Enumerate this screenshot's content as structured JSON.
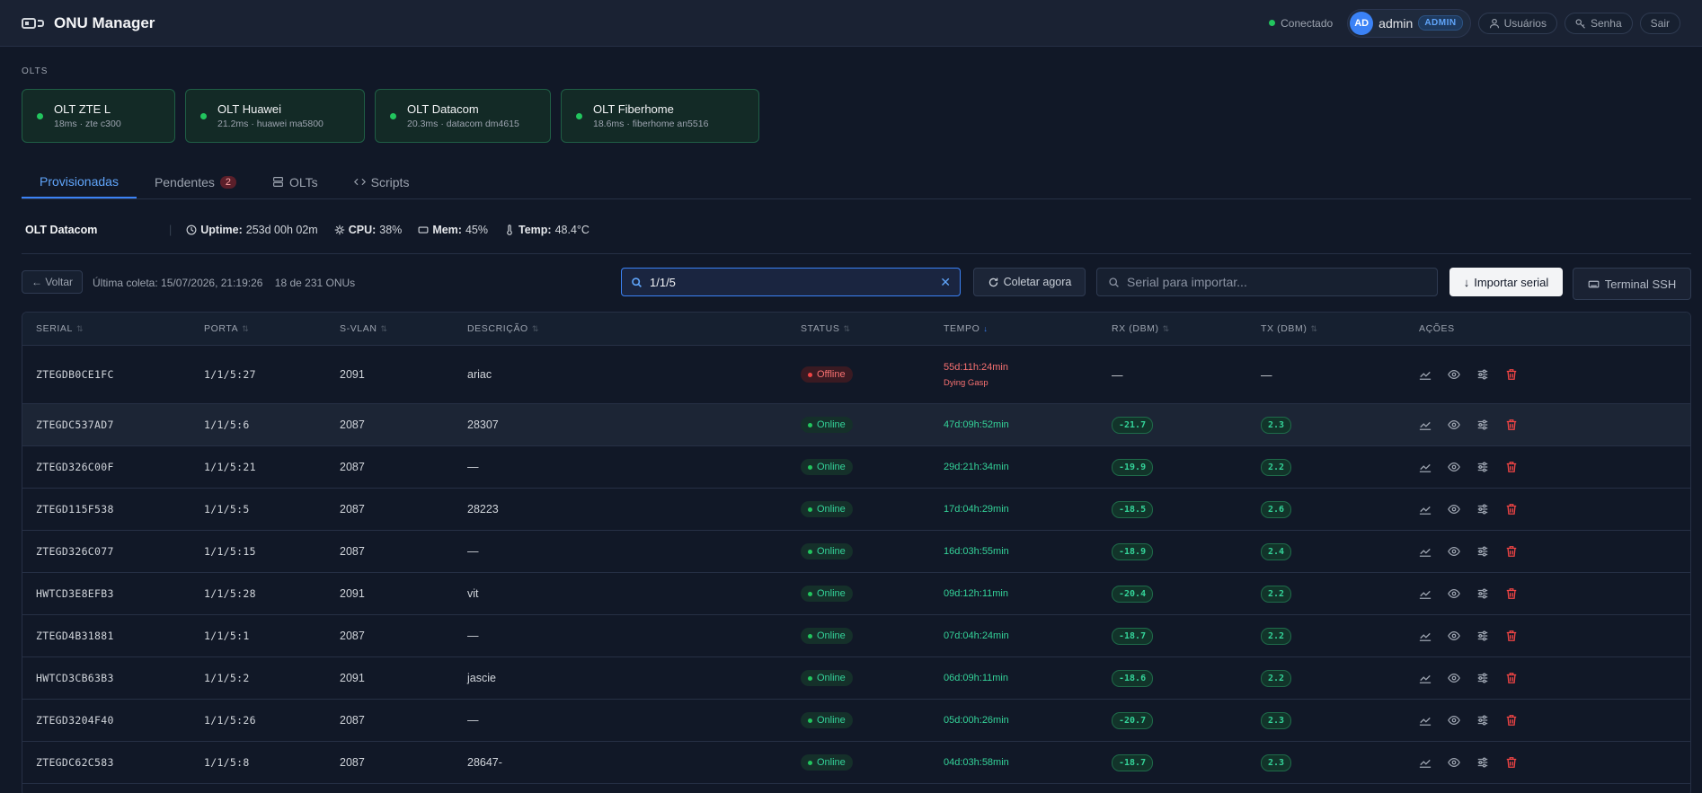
{
  "app": {
    "title": "ONU Manager"
  },
  "header": {
    "connection": "Conectado",
    "avatar": "AD",
    "username": "admin",
    "role": "ADMIN",
    "users_btn": "Usuários",
    "password_btn": "Senha",
    "logout_btn": "Sair"
  },
  "olts": {
    "label": "OLTS",
    "cards": [
      {
        "name": "OLT ZTE L",
        "sub": "18ms · zte c300",
        "width": "171"
      },
      {
        "name": "OLT Huawei",
        "sub": "21.2ms · huawei ma5800",
        "width": "200"
      },
      {
        "name": "OLT Datacom",
        "sub": "20.3ms · datacom dm4615",
        "width": "183"
      },
      {
        "name": "OLT Fiberhome",
        "sub": "18.6ms · fiberhome an5516",
        "width": "220"
      }
    ]
  },
  "tabs": [
    {
      "label": "Provisionadas"
    },
    {
      "label": "Pendentes",
      "count": "2"
    },
    {
      "label": "OLTs"
    },
    {
      "label": "Scripts"
    }
  ],
  "status": {
    "olt_name": "OLT Datacom",
    "uptime_label": "Uptime:",
    "uptime": "253d 00h 02m",
    "cpu_label": "CPU:",
    "cpu": "38%",
    "mem_label": "Mem:",
    "mem": "45%",
    "temp_label": "Temp:",
    "temp": "48.4°C"
  },
  "toolbar": {
    "back": "← Voltar",
    "last_collect": "Última coleta: 15/07/2026, 21:19:26    18 de 231 ONUs",
    "search_value": "1/1/5",
    "collect_now": "Coletar agora",
    "serial_placeholder": "Serial para importar...",
    "import_serial": "Importar serial",
    "terminal": "Terminal SSH"
  },
  "table": {
    "headers": [
      "SERIAL",
      "PORTA",
      "S-VLAN",
      "DESCRIÇÃO",
      "STATUS",
      "TEMPO",
      "RX (DBM)",
      "TX (DBM)",
      "AÇÕES"
    ],
    "rows": [
      {
        "serial": "ZTEGDB0CE1FC",
        "porta": "1/1/5:27",
        "vlan": "2091",
        "desc": "ariac",
        "status": "Offline",
        "tempo": "55d:11h:24min",
        "tempo_sub": "Dying Gasp",
        "rx": "—",
        "tx": "—"
      },
      {
        "serial": "ZTEGDC537AD7",
        "porta": "1/1/5:6",
        "vlan": "2087",
        "desc": "28307",
        "status": "Online",
        "tempo": "47d:09h:52min",
        "rx": "-21.7",
        "tx": "2.3"
      },
      {
        "serial": "ZTEGD326C00F",
        "porta": "1/1/5:21",
        "vlan": "2087",
        "desc": "—",
        "status": "Online",
        "tempo": "29d:21h:34min",
        "rx": "-19.9",
        "tx": "2.2"
      },
      {
        "serial": "ZTEGD115F538",
        "porta": "1/1/5:5",
        "vlan": "2087",
        "desc": "28223",
        "status": "Online",
        "tempo": "17d:04h:29min",
        "rx": "-18.5",
        "tx": "2.6"
      },
      {
        "serial": "ZTEGD326C077",
        "porta": "1/1/5:15",
        "vlan": "2087",
        "desc": "—",
        "status": "Online",
        "tempo": "16d:03h:55min",
        "rx": "-18.9",
        "tx": "2.4"
      },
      {
        "serial": "HWTCD3E8EFB3",
        "porta": "1/1/5:28",
        "vlan": "2091",
        "desc": "vit",
        "status": "Online",
        "tempo": "09d:12h:11min",
        "rx": "-20.4",
        "tx": "2.2"
      },
      {
        "serial": "ZTEGD4B31881",
        "porta": "1/1/5:1",
        "vlan": "2087",
        "desc": "—",
        "status": "Online",
        "tempo": "07d:04h:24min",
        "rx": "-18.7",
        "tx": "2.2"
      },
      {
        "serial": "HWTCD3CB63B3",
        "porta": "1/1/5:2",
        "vlan": "2091",
        "desc": "jascie",
        "status": "Online",
        "tempo": "06d:09h:11min",
        "rx": "-18.6",
        "tx": "2.2"
      },
      {
        "serial": "ZTEGD3204F40",
        "porta": "1/1/5:26",
        "vlan": "2087",
        "desc": "—",
        "status": "Online",
        "tempo": "05d:00h:26min",
        "rx": "-20.7",
        "tx": "2.3"
      },
      {
        "serial": "ZTEGDC62C583",
        "porta": "1/1/5:8",
        "vlan": "2087",
        "desc": "28647-",
        "status": "Online",
        "tempo": "04d:03h:58min",
        "rx": "-18.7",
        "tx": "2.3"
      }
    ]
  }
}
